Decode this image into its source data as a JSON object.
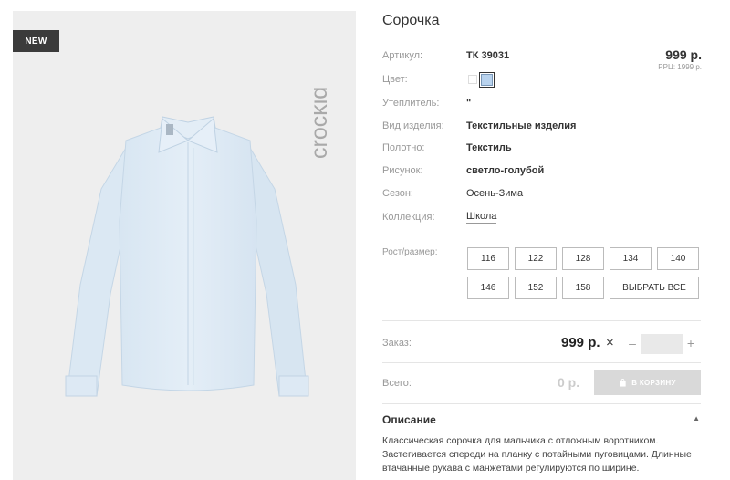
{
  "image_panel": {
    "badge": "NEW",
    "brand": "crockid"
  },
  "product": {
    "title": "Сорочка",
    "price": "999 р.",
    "rrp": "РРЦ: 1999 р."
  },
  "details": [
    {
      "label": "Артикул:",
      "value": "ТК 39031"
    },
    {
      "label": "Цвет:",
      "value": ""
    },
    {
      "label": "Утеплитель:",
      "value": "\""
    },
    {
      "label": "Вид изделия:",
      "value": "Текстильные изделия"
    },
    {
      "label": "Полотно:",
      "value": "Текстиль"
    },
    {
      "label": "Рисунок:",
      "value": "светло-голубой"
    },
    {
      "label": "Сезон:",
      "value": "Осень-Зима"
    },
    {
      "label": "Коллекция:",
      "value": "Школа"
    }
  ],
  "colors": {
    "swatch_1": "#ffffff",
    "swatch_2": "#b9d3ee"
  },
  "sizes": {
    "label": "Рост/размер:",
    "options": [
      "116",
      "122",
      "128",
      "134",
      "140",
      "146",
      "152",
      "158"
    ],
    "select_all": "ВЫБРАТЬ ВСЕ"
  },
  "order": {
    "label": "Заказ:",
    "unit_price": "999 р.",
    "times": "×",
    "minus": "–",
    "plus": "+",
    "quantity": ""
  },
  "total": {
    "label": "Всего:",
    "value": "0 р.",
    "cart_button": "В КОРЗИНУ",
    "cart_icon": "shopping-bag-icon"
  },
  "description": {
    "heading": "Описание",
    "toggle": "▲",
    "text": "Классическая сорочка для мальчика с отложным воротником. Застегивается спереди на планку с потайными пуговицами. Длинные втачанные рукава с манжетами регулируются по ширине."
  }
}
